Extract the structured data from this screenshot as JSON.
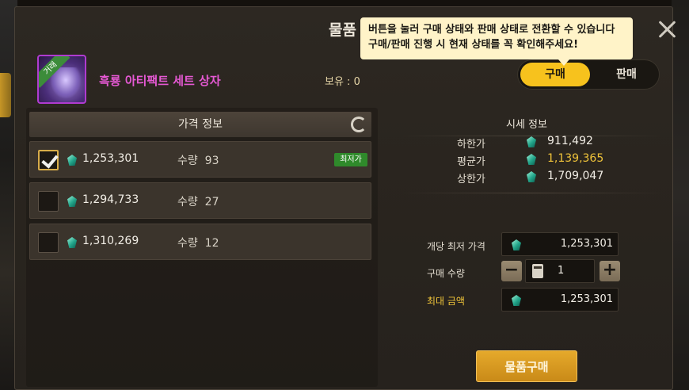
{
  "window": {
    "title": "물품"
  },
  "tooltip": {
    "line1": "버튼을 눌러 구매 상태와 판매 상태로 전환할 수 있습니다",
    "line2": "구매/판매 진행 시 현재 상태를 꼭 확인해주세요!"
  },
  "item": {
    "icon_ribbon": "거래",
    "name": "흑룡 아티팩트 세트 상자",
    "owned": "보유 : 0"
  },
  "mode_toggle": {
    "buy": "구매",
    "sell": "판매",
    "selected": "buy"
  },
  "price_info": {
    "header": "가격 정보",
    "qty_label": "수량",
    "rows": [
      {
        "price": "1,253,301",
        "qty": "93",
        "badge": "최저가",
        "checked": true
      },
      {
        "price": "1,294,733",
        "qty": "27",
        "badge": "",
        "checked": false
      },
      {
        "price": "1,310,269",
        "qty": "12",
        "badge": "",
        "checked": false
      }
    ]
  },
  "market_info": {
    "title": "시세 정보",
    "low_label": "하한가",
    "low_value": "911,492",
    "avg_label": "평균가",
    "avg_value": "1,139,365",
    "high_label": "상한가",
    "high_value": "1,709,047"
  },
  "order": {
    "unit_price_label": "개당 최저 가격",
    "unit_price": "1,253,301",
    "qty_label": "구매 수량",
    "qty": "1",
    "max_label": "최대 금액",
    "max_total": "1,253,301",
    "minus": "−",
    "plus": "+"
  },
  "buy_button": "물품구매",
  "colors": {
    "accent": "#f7c21d",
    "item_name": "#e659d4",
    "average": "#f0c43a",
    "badge": "#2f8a2b"
  }
}
